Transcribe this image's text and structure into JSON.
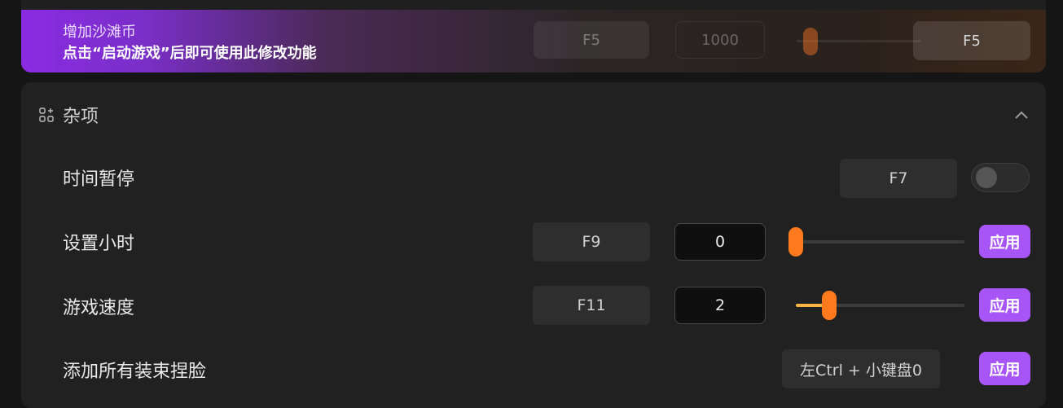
{
  "promo": {
    "title": "增加沙滩币",
    "subtitle": "点击“启动游戏”后即可使用此修改功能",
    "hotkey": "F5",
    "value": "1000",
    "apply_hotkey": "F5"
  },
  "section": {
    "title": "杂项",
    "icon": "grid-plus-icon",
    "collapse_icon": "chevron-up-icon",
    "rows": [
      {
        "label": "时间暂停",
        "hotkey": "F7",
        "toggle_on": false
      },
      {
        "label": "设置小时",
        "hotkey": "F9",
        "value": "0",
        "slider_level": 0.0,
        "apply": "应用"
      },
      {
        "label": "游戏速度",
        "hotkey": "F11",
        "value": "2",
        "slider_level": 0.2,
        "apply": "应用"
      },
      {
        "label": "添加所有装束捏脸",
        "hotkey": "左Ctrl + 小键盘0",
        "apply": "应用"
      }
    ]
  },
  "colors": {
    "accent": "#a855f7",
    "slider_thumb": "#ff7a1c",
    "slider_fill": "#ffb347"
  }
}
